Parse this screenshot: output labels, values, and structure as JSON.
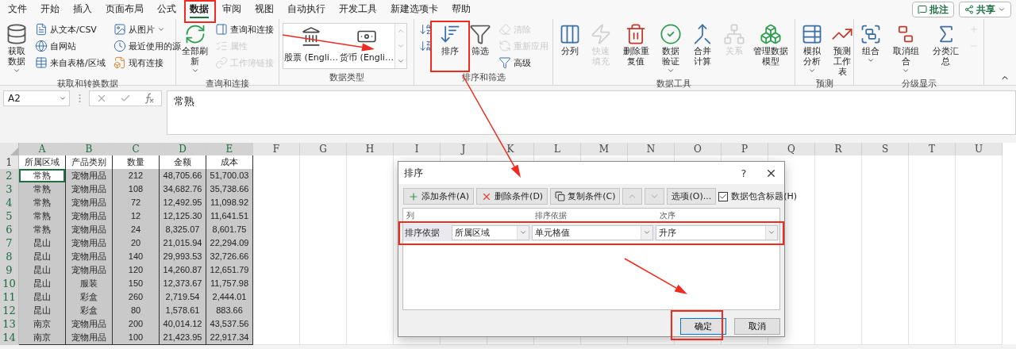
{
  "menu_tabs": [
    {
      "label": "文件",
      "selected": false
    },
    {
      "label": "开始",
      "selected": false
    },
    {
      "label": "插入",
      "selected": false
    },
    {
      "label": "页面布局",
      "selected": false
    },
    {
      "label": "公式",
      "selected": false
    },
    {
      "label": "数据",
      "selected": true
    },
    {
      "label": "审阅",
      "selected": false
    },
    {
      "label": "视图",
      "selected": false
    },
    {
      "label": "自动执行",
      "selected": false
    },
    {
      "label": "开发工具",
      "selected": false
    },
    {
      "label": "新建选项卡",
      "selected": false
    },
    {
      "label": "帮助",
      "selected": false
    }
  ],
  "header_buttons": [
    {
      "label": "批注",
      "dropdown": false
    },
    {
      "label": "共享",
      "dropdown": true
    }
  ],
  "ribbon_groups": [
    {
      "title": "获取和转换数据",
      "items": [
        {
          "kind": "large",
          "label": "获取数据",
          "dropdown": true,
          "disabled": false
        },
        {
          "kind": "small",
          "label": "从文本/CSV",
          "dropdown": false,
          "disabled": false
        },
        {
          "kind": "small",
          "label": "自网站",
          "dropdown": false,
          "disabled": false
        },
        {
          "kind": "small",
          "label": "来自表格/区域",
          "dropdown": false,
          "disabled": false
        },
        {
          "kind": "small",
          "label": "从图片",
          "dropdown": true,
          "disabled": false
        },
        {
          "kind": "small",
          "label": "最近使用的源",
          "dropdown": false,
          "disabled": false
        },
        {
          "kind": "small",
          "label": "现有连接",
          "dropdown": false,
          "disabled": false
        }
      ]
    },
    {
      "title": "查询和连接",
      "items": [
        {
          "kind": "large",
          "label": "全部刷新",
          "dropdown": true,
          "disabled": false
        },
        {
          "kind": "small",
          "label": "查询和连接",
          "dropdown": false,
          "disabled": false
        },
        {
          "kind": "small",
          "label": "属性",
          "dropdown": false,
          "disabled": true
        },
        {
          "kind": "small",
          "label": "工作簿链接",
          "dropdown": false,
          "disabled": true
        }
      ]
    },
    {
      "title": "数据类型",
      "items": [
        {
          "kind": "gallery",
          "options": [
            "股票 (Engli…",
            "货币 (Engli…"
          ],
          "dropdown": false,
          "disabled": false
        }
      ]
    },
    {
      "title": "排序和筛选",
      "items": [
        {
          "kind": "icon",
          "disabled": false
        },
        {
          "kind": "icon",
          "disabled": false
        },
        {
          "kind": "large",
          "label": "排序",
          "dropdown": false,
          "disabled": false
        },
        {
          "kind": "large",
          "label": "筛选",
          "dropdown": false,
          "disabled": false
        },
        {
          "kind": "small",
          "label": "清除",
          "dropdown": false,
          "disabled": true
        },
        {
          "kind": "small",
          "label": "重新应用",
          "dropdown": false,
          "disabled": true
        },
        {
          "kind": "small",
          "label": "高级",
          "dropdown": false,
          "disabled": false
        }
      ]
    },
    {
      "title": "数据工具",
      "items": [
        {
          "kind": "large",
          "label": "分列",
          "dropdown": false,
          "disabled": false
        },
        {
          "kind": "large",
          "label": "快速填充",
          "dropdown": false,
          "disabled": true
        },
        {
          "kind": "large",
          "label": "删除重复值",
          "dropdown": false,
          "disabled": false
        },
        {
          "kind": "large",
          "label": "数据验证",
          "dropdown": true,
          "disabled": false
        },
        {
          "kind": "large",
          "label": "合并计算",
          "dropdown": false,
          "disabled": false
        },
        {
          "kind": "large",
          "label": "关系",
          "dropdown": false,
          "disabled": true
        },
        {
          "kind": "large",
          "label": "管理数据模型",
          "dropdown": false,
          "disabled": false
        }
      ]
    },
    {
      "title": "预测",
      "items": [
        {
          "kind": "large",
          "label": "模拟分析",
          "dropdown": true,
          "disabled": false
        },
        {
          "kind": "large",
          "label": "预测工作表",
          "dropdown": false,
          "disabled": false
        }
      ]
    },
    {
      "title": "分级显示",
      "items": [
        {
          "kind": "large",
          "label": "组合",
          "dropdown": true,
          "disabled": false
        },
        {
          "kind": "large",
          "label": "取消组合",
          "dropdown": true,
          "disabled": false
        },
        {
          "kind": "large",
          "label": "分类汇总",
          "dropdown": false,
          "disabled": false
        },
        {
          "kind": "icon",
          "disabled": true
        },
        {
          "kind": "icon",
          "disabled": true
        }
      ]
    }
  ],
  "formula_bar": {
    "name_box": "A2",
    "content": "常熟"
  },
  "sheet": {
    "columns": [
      {
        "label": "A",
        "selected": true
      },
      {
        "label": "B",
        "selected": true
      },
      {
        "label": "C",
        "selected": true
      },
      {
        "label": "D",
        "selected": true
      },
      {
        "label": "E",
        "selected": true
      },
      {
        "label": "F",
        "selected": false
      },
      {
        "label": "G",
        "selected": false
      },
      {
        "label": "H",
        "selected": false
      },
      {
        "label": "I",
        "selected": false
      },
      {
        "label": "J",
        "selected": false
      },
      {
        "label": "K",
        "selected": false
      },
      {
        "label": "L",
        "selected": false
      },
      {
        "label": "M",
        "selected": false
      },
      {
        "label": "N",
        "selected": false
      },
      {
        "label": "O",
        "selected": false
      },
      {
        "label": "P",
        "selected": false
      },
      {
        "label": "Q",
        "selected": false
      },
      {
        "label": "R",
        "selected": false
      },
      {
        "label": "S",
        "selected": false
      },
      {
        "label": "T",
        "selected": false
      },
      {
        "label": "U",
        "selected": false
      }
    ],
    "rows": [
      {
        "number": "1",
        "selected": false,
        "active": false,
        "cells": [
          "所属区域",
          "产品类别",
          "数量",
          "金额",
          "成本"
        ]
      },
      {
        "number": "2",
        "selected": true,
        "active": true,
        "cells": [
          "常熟",
          "宠物用品",
          "212",
          "48,705.66",
          "51,700.03"
        ]
      },
      {
        "number": "3",
        "selected": true,
        "active": false,
        "cells": [
          "常熟",
          "宠物用品",
          "108",
          "34,682.76",
          "35,738.66"
        ]
      },
      {
        "number": "4",
        "selected": true,
        "active": false,
        "cells": [
          "常熟",
          "宠物用品",
          "72",
          "12,492.95",
          "11,098.92"
        ]
      },
      {
        "number": "5",
        "selected": true,
        "active": false,
        "cells": [
          "常熟",
          "宠物用品",
          "12",
          "12,125.30",
          "11,641.51"
        ]
      },
      {
        "number": "6",
        "selected": true,
        "active": false,
        "cells": [
          "常熟",
          "宠物用品",
          "24",
          "8,325.07",
          "8,601.75"
        ]
      },
      {
        "number": "7",
        "selected": true,
        "active": false,
        "cells": [
          "昆山",
          "宠物用品",
          "20",
          "21,015.94",
          "22,294.09"
        ]
      },
      {
        "number": "8",
        "selected": true,
        "active": false,
        "cells": [
          "昆山",
          "宠物用品",
          "140",
          "29,993.53",
          "32,726.66"
        ]
      },
      {
        "number": "9",
        "selected": true,
        "active": false,
        "cells": [
          "昆山",
          "宠物用品",
          "120",
          "14,260.87",
          "12,651.79"
        ]
      },
      {
        "number": "10",
        "selected": true,
        "active": false,
        "cells": [
          "昆山",
          "服装",
          "150",
          "12,373.67",
          "11,757.98"
        ]
      },
      {
        "number": "11",
        "selected": true,
        "active": false,
        "cells": [
          "昆山",
          "彩盒",
          "260",
          "2,719.54",
          "2,444.01"
        ]
      },
      {
        "number": "12",
        "selected": true,
        "active": false,
        "cells": [
          "昆山",
          "彩盒",
          "80",
          "1,578.61",
          "883.66"
        ]
      },
      {
        "number": "13",
        "selected": true,
        "active": false,
        "cells": [
          "南京",
          "宠物用品",
          "200",
          "40,014.12",
          "43,537.56"
        ]
      },
      {
        "number": "14",
        "selected": true,
        "active": false,
        "cells": [
          "南京",
          "宠物用品",
          "100",
          "21,423.95",
          "22,917.34"
        ]
      }
    ]
  },
  "sort_dialog": {
    "title": "排序",
    "help": "?",
    "toolbar": [
      {
        "kind": "add",
        "label": "添加条件(A)",
        "disabled": false
      },
      {
        "kind": "delete",
        "label": "删除条件(D)",
        "disabled": false
      },
      {
        "kind": "copy",
        "label": "复制条件(C)",
        "disabled": false
      },
      {
        "kind": "move_up",
        "disabled": true
      },
      {
        "kind": "move_down",
        "disabled": true
      },
      {
        "kind": "options",
        "label": "选项(O)...",
        "disabled": false
      }
    ],
    "has_headers": {
      "label": "数据包含标题(H)",
      "checked": true
    },
    "columns": [
      "列",
      "排序依据",
      "次序"
    ],
    "conditions": [
      {
        "label": "排序依据",
        "column": "所属区域",
        "sort_on": "单元格值",
        "order": "升序",
        "selected": true
      }
    ],
    "buttons": [
      {
        "label": "确定",
        "default": true
      },
      {
        "label": "取消",
        "default": false
      }
    ]
  }
}
